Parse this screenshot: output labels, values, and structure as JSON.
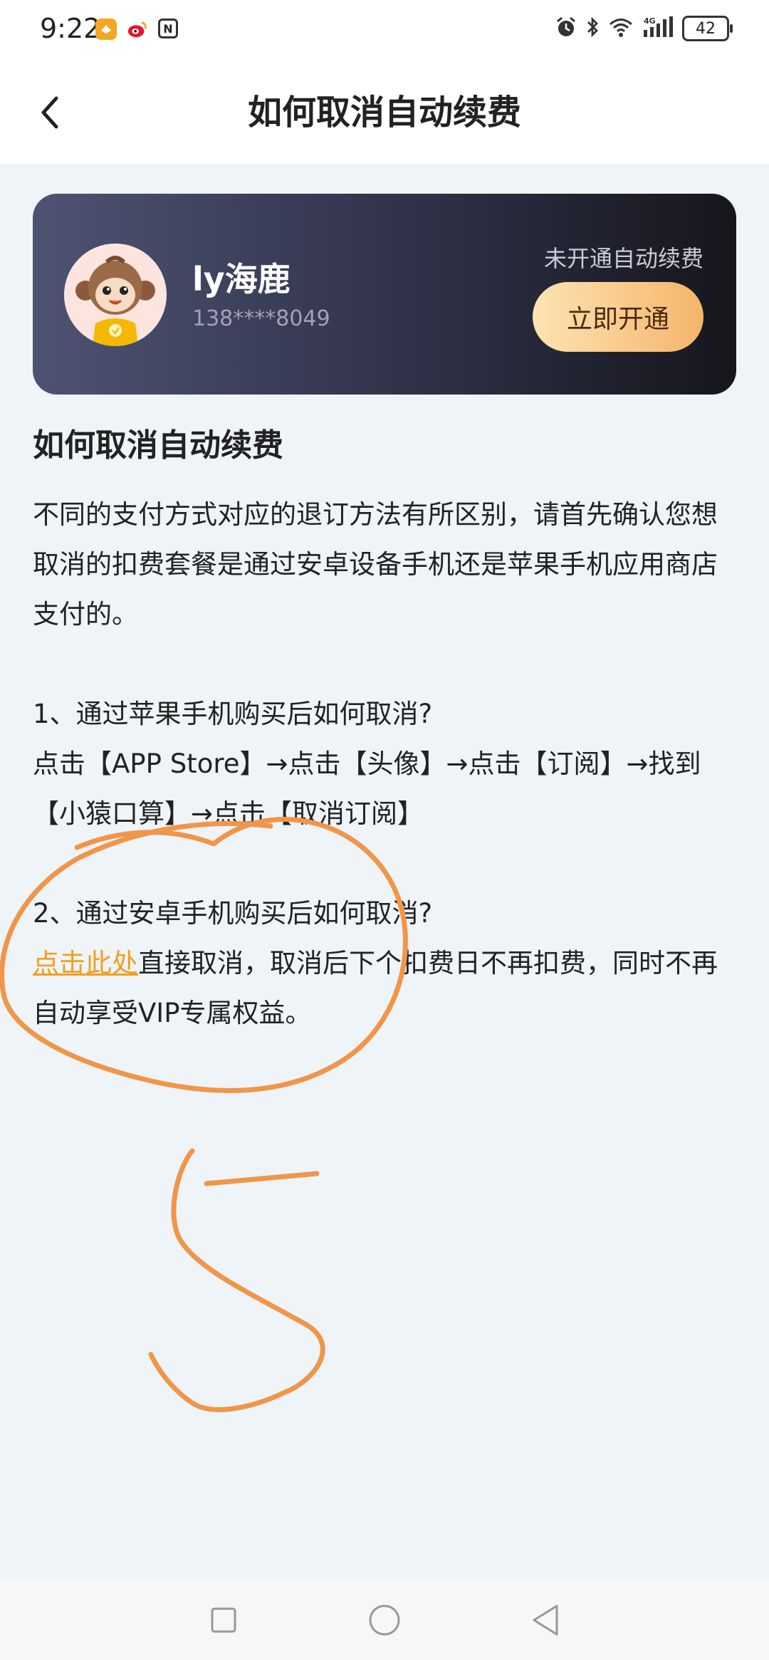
{
  "status_bar": {
    "time": "9:22",
    "battery": "42",
    "network": "4G",
    "icons": [
      "app-notification-icon",
      "weibo-icon",
      "nfc-icon",
      "alarm-icon",
      "bluetooth-icon",
      "wifi-icon",
      "signal-icon",
      "battery-icon"
    ]
  },
  "header": {
    "title": "如何取消自动续费",
    "back_icon": "chevron-left-icon"
  },
  "member_card": {
    "user_name": "ly海鹿",
    "phone": "138****8049",
    "renew_status": "未开通自动续费",
    "open_button_label": "立即开通",
    "avatar_icon": "monkey-avatar-icon",
    "accent_color": "#f5b56a"
  },
  "content": {
    "heading": "如何取消自动续费",
    "intro": "不同的支付方式对应的退订方法有所区别，请首先确认您想取消的扣费套餐是通过安卓设备手机还是苹果手机应用商店支付的。",
    "step1_title": "1、通过苹果手机购买后如何取消?",
    "step1_detail": "点击【APP Store】→点击【头像】→点击【订阅】→找到【小猿口算】→点击【取消订阅】",
    "step2_title": "2、通过安卓手机购买后如何取消?",
    "step2_link": "点击此处",
    "step2_detail": "直接取消，取消后下个扣费日不再扣费，同时不再自动享受VIP专属权益。",
    "link_color": "#f0a020"
  },
  "annotation": {
    "color": "#f0964a",
    "handwritten_mark": "5"
  },
  "nav_bar": {
    "icons": [
      "recents-square-icon",
      "home-circle-icon",
      "back-triangle-icon"
    ]
  }
}
